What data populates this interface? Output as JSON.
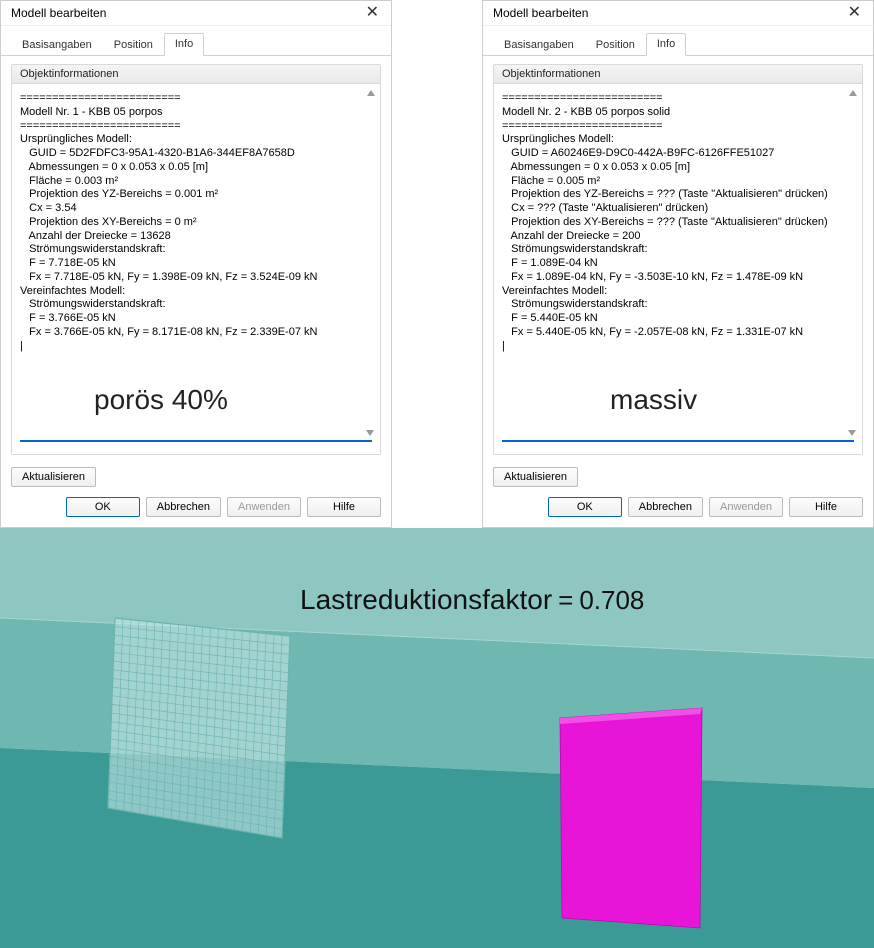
{
  "dialogs": [
    {
      "title": "Modell bearbeiten",
      "tabs": [
        "Basisangaben",
        "Position",
        "Info"
      ],
      "active_tab": 2,
      "group_header": "Objektinformationen",
      "info_text": "=========================\nModell Nr. 1 - KBB 05 porpos\n=========================\nUrsprüngliches Modell:\n   GUID = 5D2FDFC3-95A1-4320-B1A6-344EF8A7658D\n   Abmessungen = 0 x 0.053 x 0.05 [m]\n   Fläche = 0.003 m²\n   Projektion des YZ-Bereichs = 0.001 m²\n   Cx = 3.54\n   Projektion des XY-Bereichs = 0 m²\n   Anzahl der Dreiecke = 13628\n   Strömungswiderstandskraft:\n   F = 7.718E-05 kN\n   Fx = 7.718E-05 kN, Fy = 1.398E-09 kN, Fz = 3.524E-09 kN\nVereinfachtes Modell:\n   Strömungswiderstandskraft:\n   F = 3.766E-05 kN\n   Fx = 3.766E-05 kN, Fy = 8.171E-08 kN, Fz = 2.339E-07 kN\n|",
      "overlay": "porös 40%",
      "update_label": "Aktualisieren",
      "buttons": {
        "ok": "OK",
        "cancel": "Abbrechen",
        "apply": "Anwenden",
        "help": "Hilfe"
      }
    },
    {
      "title": "Modell bearbeiten",
      "tabs": [
        "Basisangaben",
        "Position",
        "Info"
      ],
      "active_tab": 2,
      "group_header": "Objektinformationen",
      "info_text": "=========================\nModell Nr. 2 - KBB 05 porpos solid\n=========================\nUrsprüngliches Modell:\n   GUID = A60246E9-D9C0-442A-B9FC-6126FFE51027\n   Abmessungen = 0 x 0.053 x 0.05 [m]\n   Fläche = 0.005 m²\n   Projektion des YZ-Bereichs = ??? (Taste \"Aktualisieren\" drücken)\n   Cx = ??? (Taste \"Aktualisieren\" drücken)\n   Projektion des XY-Bereichs = ??? (Taste \"Aktualisieren\" drücken)\n   Anzahl der Dreiecke = 200\n   Strömungswiderstandskraft:\n   F = 1.089E-04 kN\n   Fx = 1.089E-04 kN, Fy = -3.503E-10 kN, Fz = 1.478E-09 kN\nVereinfachtes Modell:\n   Strömungswiderstandskraft:\n   F = 5.440E-05 kN\n   Fx = 5.440E-05 kN, Fy = -2.057E-08 kN, Fz = 1.331E-07 kN\n|",
      "overlay": "massiv",
      "update_label": "Aktualisieren",
      "buttons": {
        "ok": "OK",
        "cancel": "Abbrechen",
        "apply": "Anwenden",
        "help": "Hilfe"
      }
    }
  ],
  "viewport": {
    "label": "Lastreduktionsfaktor",
    "equals": "=",
    "value": "0.708",
    "colors": {
      "floor_near": "#3b9a95",
      "floor_far": "#6fb7b1",
      "wall": "#8ec7c2",
      "mesh": "#c6e6e6",
      "mesh_line": "#6bb4b0",
      "solid": "#e815d8"
    }
  }
}
